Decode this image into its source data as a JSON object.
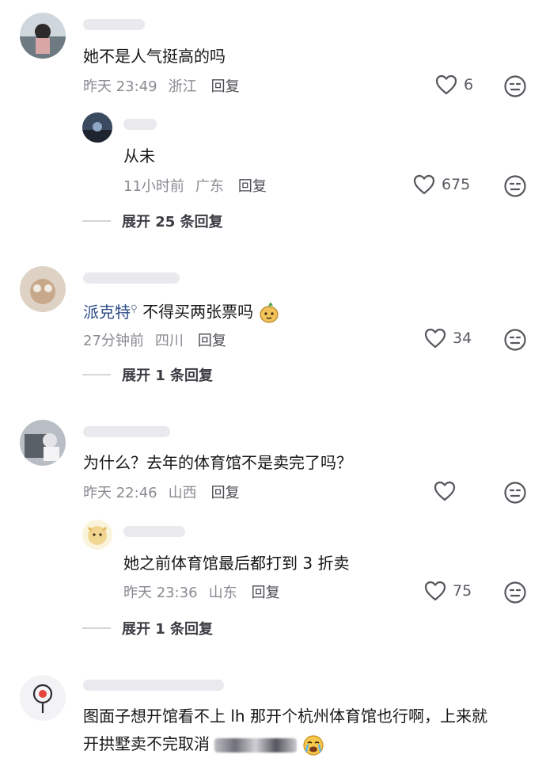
{
  "comments": [
    {
      "text": "她不是人气挺高的吗",
      "time": "昨天 23:49",
      "location": "浙江",
      "reply_label": "回复",
      "likes": "6",
      "replies": [
        {
          "text": "从未",
          "time": "11小时前",
          "location": "广东",
          "reply_label": "回复",
          "likes": "675"
        }
      ],
      "expand_label": "展开 25 条回复"
    },
    {
      "mention": "派克特",
      "text": "不得买两张票吗",
      "time": "27分钟前",
      "location": "四川",
      "reply_label": "回复",
      "likes": "34",
      "expand_label": "展开 1 条回复"
    },
    {
      "text": "为什么？去年的体育馆不是卖完了吗？",
      "time": "昨天 22:46",
      "location": "山西",
      "reply_label": "回复",
      "likes": "",
      "replies": [
        {
          "text": "她之前体育馆最后都打到 3 折卖",
          "time": "昨天 23:36",
          "location": "山东",
          "reply_label": "回复",
          "likes": "75"
        }
      ],
      "expand_label": "展开 1 条回复"
    },
    {
      "text_line1": "图面子想开馆看不上 lh 那开个杭州体育馆也行啊，上来就",
      "text_line2": "开拱墅卖不完取消"
    }
  ],
  "colors": {
    "meta": "#8a8a92",
    "mention": "#2b4a86",
    "divider": "#d5d5da"
  },
  "icons": [
    "heart-icon",
    "dislike-face-icon",
    "search-mark-icon",
    "emoji-icon",
    "crying-emoji-icon"
  ]
}
